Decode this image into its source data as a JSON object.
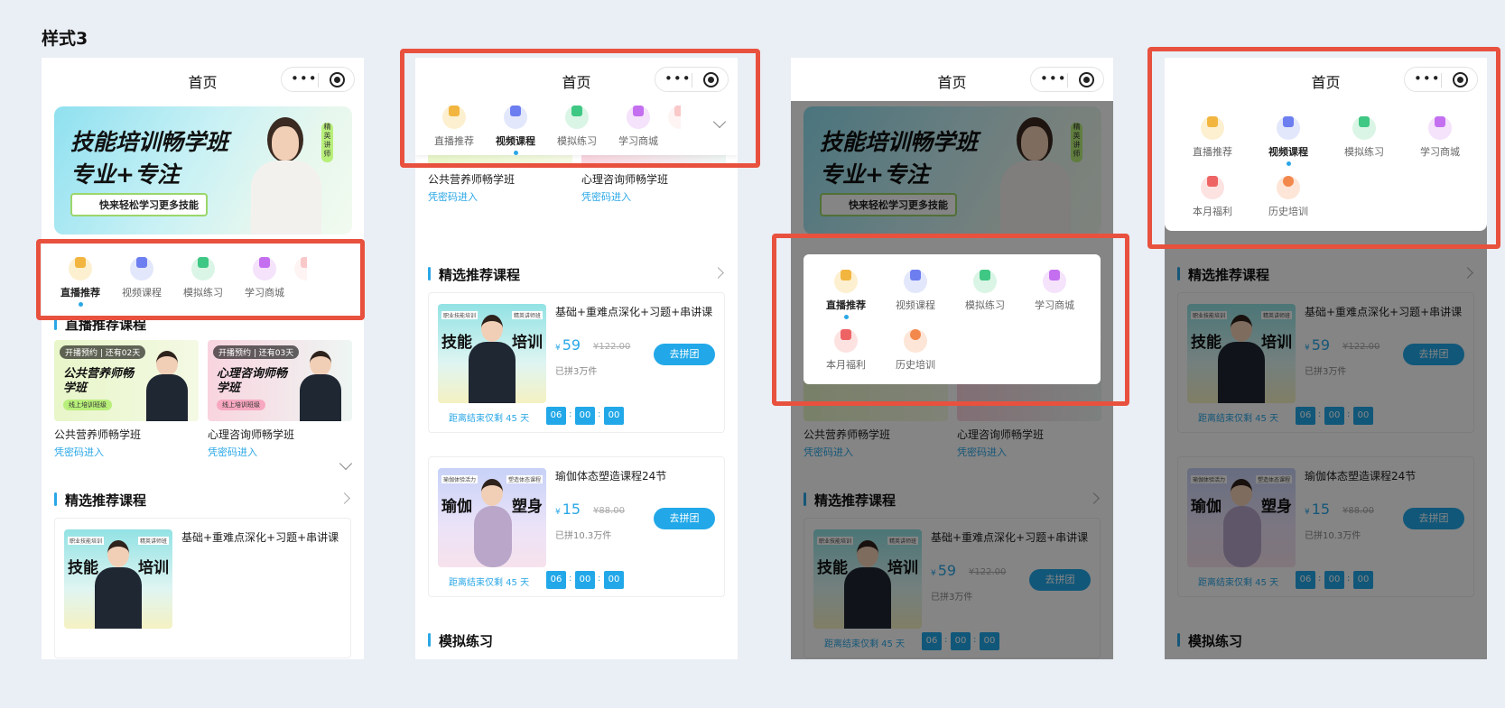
{
  "page_title": "样式3",
  "nav_title": "首页",
  "capsule": {
    "more": "•••"
  },
  "banner": {
    "line1": "技能培训畅学班",
    "line2": "专业+专注",
    "slogan": "快来轻松学习更多技能",
    "tag": "精英讲师"
  },
  "tabs": [
    "直播推荐",
    "视频课程",
    "模拟练习",
    "学习商城",
    "本月福利",
    "历史培训"
  ],
  "sections": {
    "live": "直播推荐课程",
    "featured": "精选推荐课程",
    "practice": "模拟练习"
  },
  "live_cards": [
    {
      "badge": "开播预约 | 还有02天",
      "thumb_title": "公共营养师畅学班",
      "thumb_tag": "线上培训班级",
      "name": "公共营养师畅学班",
      "link": "凭密码进入"
    },
    {
      "badge": "开播预约 | 还有03天",
      "thumb_title": "心理咨询师畅学班",
      "thumb_tag": "线上培训班级",
      "name": "心理咨询师畅学班",
      "link": "凭密码进入"
    }
  ],
  "courses": [
    {
      "thumb_left": "技能",
      "thumb_right": "培训",
      "thumb_tag_left": "职业技能培训",
      "thumb_tag_right": "精英讲师班",
      "title": "基础+重难点深化+习题+串讲课",
      "currency": "¥",
      "price": "59",
      "old_price": "¥122.00",
      "sold": "已拼3万件",
      "button": "去拼团",
      "countdown_label": "距离结束仅剩 45 天",
      "time": [
        "06",
        "00",
        "00"
      ]
    },
    {
      "thumb_left": "瑜伽",
      "thumb_right": "塑身",
      "thumb_tag_left": "瑜伽体验活力",
      "thumb_tag_right": "塑造体态课程",
      "title": "瑜伽体态塑造课程24节",
      "currency": "¥",
      "price": "15",
      "old_price": "¥88.00",
      "sold": "已拼10.3万件",
      "button": "去拼团",
      "countdown_label": "距离结束仅剩 45 天",
      "time": [
        "06",
        "00",
        "00"
      ]
    }
  ],
  "colors": {
    "accent": "#22a8e8",
    "highlight": "#e8513e",
    "background": "#eaeef5"
  }
}
